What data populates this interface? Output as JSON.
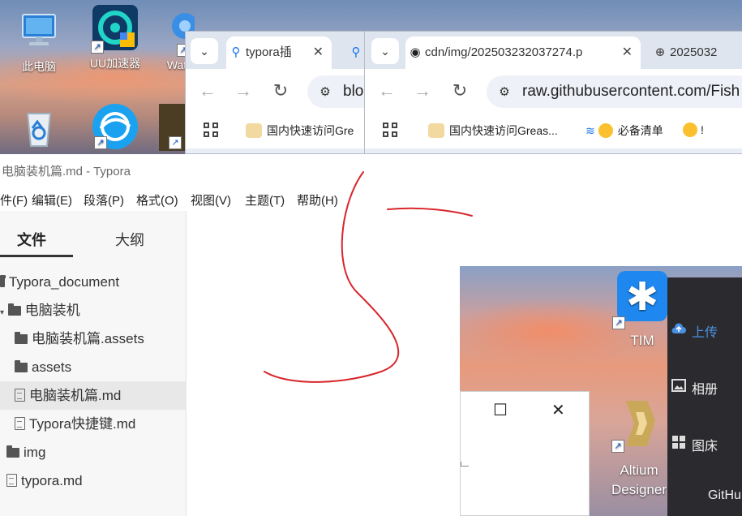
{
  "desktop": {
    "icons": [
      {
        "label": "此电脑",
        "icon": "computer-icon"
      },
      {
        "label": "UU加速器",
        "icon": "uu-accelerator-icon"
      },
      {
        "label": "Watt",
        "icon": "watt-toolkit-icon"
      },
      {
        "label": "",
        "icon": "recycle-bin-icon"
      },
      {
        "label": "",
        "icon": "battlenet-icon"
      }
    ]
  },
  "browser_back": {
    "tab_active": "typora插",
    "omnibox_text": "blo",
    "bookmark": "国内快速访问Gre"
  },
  "browser_front": {
    "tab_active": "cdn/img/202503232037274.p",
    "tab_next": "2025032",
    "omnibox_text": "raw.githubusercontent.com/Fish",
    "bookmarks": [
      "国内快速访问Greas...",
      "必备清单",
      "!"
    ]
  },
  "typora": {
    "title": "电脑装机篇.md - Typora",
    "menu": [
      "件(F)",
      "编辑(E)",
      "段落(P)",
      "格式(O)",
      "视图(V)",
      "主题(T)",
      "帮助(H)"
    ],
    "sidebar_tabs": [
      "文件",
      "大纲"
    ],
    "tree": [
      {
        "label": "Typora_document",
        "type": "folder"
      },
      {
        "label": "电脑装机",
        "type": "folder"
      },
      {
        "label": "电脑装机篇.assets",
        "type": "folder"
      },
      {
        "label": "assets",
        "type": "folder"
      },
      {
        "label": "电脑装机篇.md",
        "type": "file"
      },
      {
        "label": "Typora快捷键.md",
        "type": "file"
      },
      {
        "label": "img",
        "type": "folder"
      },
      {
        "label": "typora.md",
        "type": "file"
      }
    ]
  },
  "overlay_desktop": {
    "icons": [
      {
        "label": "TIM",
        "icon": "tim-icon"
      },
      {
        "label": "Altium Designer",
        "icon": "altium-icon"
      }
    ]
  },
  "dark_panel": {
    "items": [
      "上传",
      "相册",
      "图床",
      "GitHu"
    ],
    "accent": "#4a90e2"
  },
  "small_window": {
    "maximize_glyph": "☐",
    "close_glyph": "✕"
  },
  "colors": {
    "accent": "#1a73e8",
    "scribble": "#d8262b"
  }
}
